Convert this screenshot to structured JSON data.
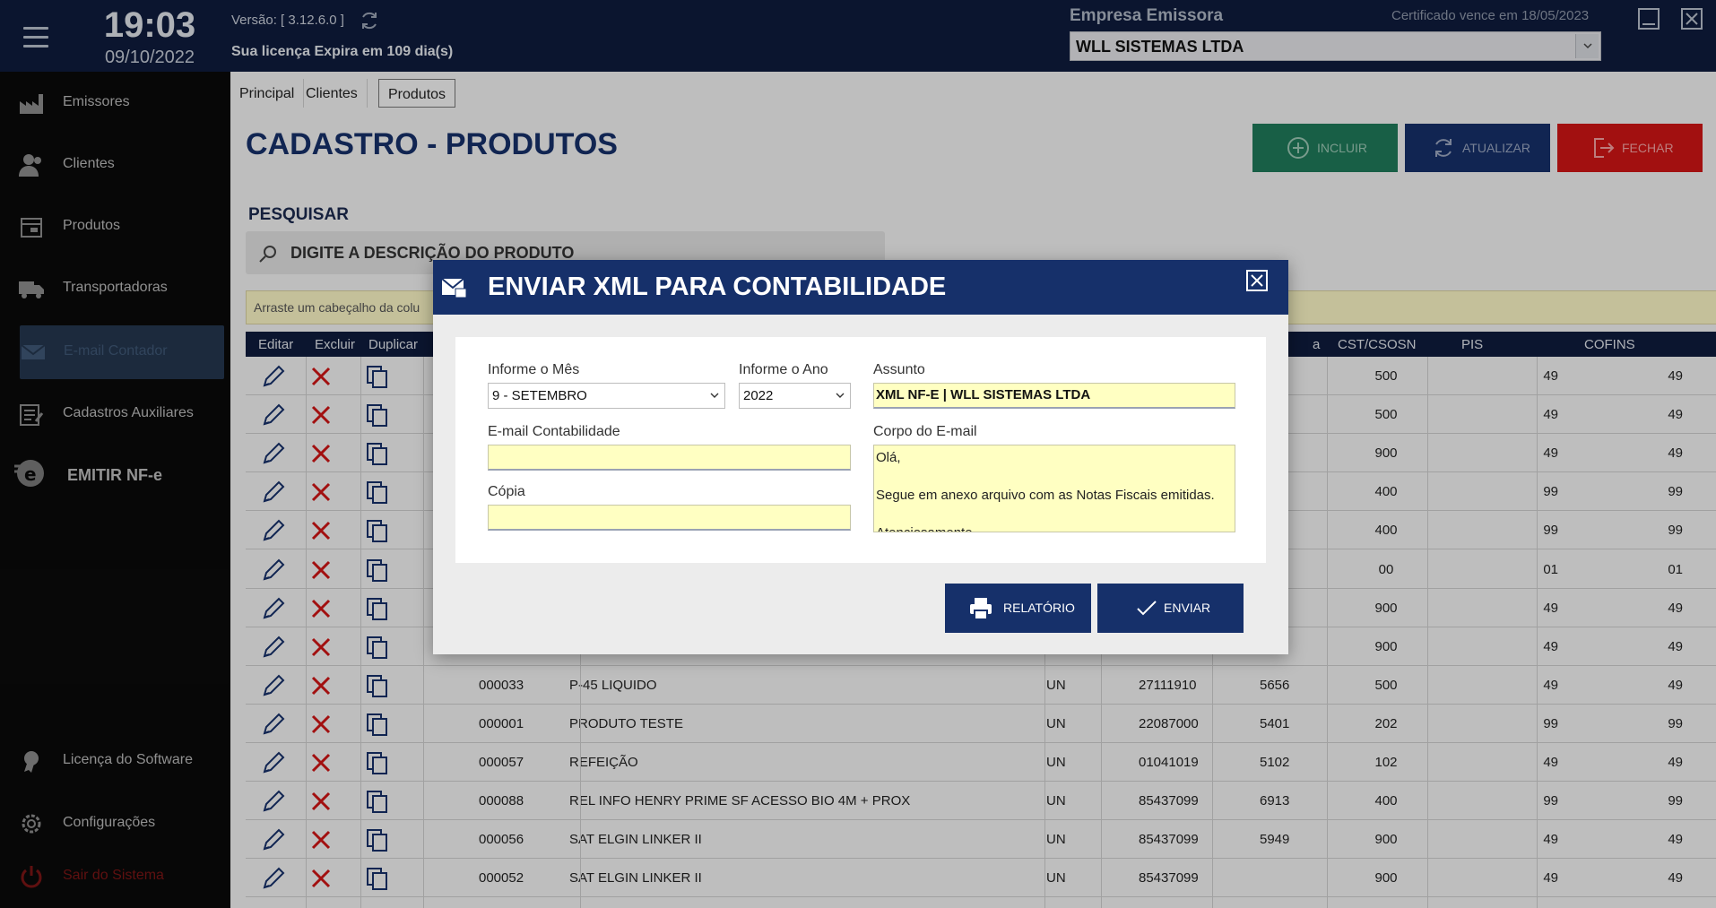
{
  "header": {
    "time": "19:03",
    "date": "09/10/2022",
    "version": "Versão: [ 3.12.6.0 ]",
    "license_notice": "Sua licença Expira em 109 dia(s)",
    "company_label": "Empresa Emissora",
    "certificate_notice": "Certificado vence em 18/05/2023",
    "company_selected": "WLL SISTEMAS LTDA"
  },
  "sidebar": {
    "items": [
      {
        "label": "Emissores",
        "icon": "factory-icon"
      },
      {
        "label": "Clientes",
        "icon": "users-icon"
      },
      {
        "label": "Produtos",
        "icon": "box-icon"
      },
      {
        "label": "Transportadoras",
        "icon": "truck-icon"
      },
      {
        "label": "E-mail Contador",
        "icon": "mail-icon"
      },
      {
        "label": "Cadastros Auxiliares",
        "icon": "form-icon"
      },
      {
        "label": "EMITIR NF-e",
        "icon": "emit-icon"
      },
      {
        "label": "Licença do Software",
        "icon": "certificate-icon"
      },
      {
        "label": "Configurações",
        "icon": "gear-icon"
      },
      {
        "label": "Sair do Sistema",
        "icon": "power-icon"
      }
    ]
  },
  "tabs": [
    "Principal",
    "Clientes",
    "Produtos"
  ],
  "page": {
    "title": "CADASTRO - PRODUTOS",
    "btn_incluir": "INCLUIR",
    "btn_atualizar": "ATUALIZAR",
    "btn_fechar": "FECHAR",
    "search_label": "PESQUISAR",
    "search_placeholder": "DIGITE A DESCRIÇÃO DO PRODUTO",
    "group_hint": "Arraste um cabeçalho da colu",
    "colors": {
      "incluir": "#1f7a5a",
      "atualizar": "#16306a",
      "fechar": "#d01515"
    }
  },
  "grid": {
    "headers": [
      "Editar",
      "Excluir",
      "Duplicar",
      "a",
      "CST/CSOSN",
      "PIS",
      "COFINS"
    ],
    "rows": [
      {
        "code": "",
        "desc": "",
        "un": "",
        "ncm": "",
        "cfop": "",
        "cst": "500",
        "pis": "49",
        "cofins": "49"
      },
      {
        "code": "",
        "desc": "",
        "un": "",
        "ncm": "",
        "cfop": "",
        "cst": "500",
        "pis": "49",
        "cofins": "49"
      },
      {
        "code": "",
        "desc": "",
        "un": "",
        "ncm": "",
        "cfop": "",
        "cst": "900",
        "pis": "49",
        "cofins": "49"
      },
      {
        "code": "",
        "desc": "",
        "un": "",
        "ncm": "",
        "cfop": "",
        "cst": "400",
        "pis": "99",
        "cofins": "99"
      },
      {
        "code": "",
        "desc": "",
        "un": "",
        "ncm": "",
        "cfop": "",
        "cst": "400",
        "pis": "99",
        "cofins": "99"
      },
      {
        "code": "",
        "desc": "",
        "un": "",
        "ncm": "",
        "cfop": "",
        "cst": "00",
        "pis": "01",
        "cofins": "01"
      },
      {
        "code": "",
        "desc": "",
        "un": "",
        "ncm": "",
        "cfop": "",
        "cst": "900",
        "pis": "49",
        "cofins": "49"
      },
      {
        "code": "",
        "desc": "",
        "un": "",
        "ncm": "",
        "cfop": "",
        "cst": "900",
        "pis": "49",
        "cofins": "49"
      },
      {
        "code": "000033",
        "desc": "P-45 LIQUIDO",
        "un": "UN",
        "ncm": "27111910",
        "cfop": "5656",
        "cst": "500",
        "pis": "49",
        "cofins": "49"
      },
      {
        "code": "000001",
        "desc": "PRODUTO TESTE",
        "un": "UN",
        "ncm": "22087000",
        "cfop": "5401",
        "cst": "202",
        "pis": "99",
        "cofins": "99"
      },
      {
        "code": "000057",
        "desc": "REFEIÇÃO",
        "un": "UN",
        "ncm": "01041019",
        "cfop": "5102",
        "cst": "102",
        "pis": "49",
        "cofins": "49"
      },
      {
        "code": "000088",
        "desc": "REL INFO HENRY PRIME SF ACESSO BIO 4M + PROX",
        "un": "UN",
        "ncm": "85437099",
        "cfop": "6913",
        "cst": "400",
        "pis": "99",
        "cofins": "99"
      },
      {
        "code": "000056",
        "desc": "SAT ELGIN LINKER II",
        "un": "UN",
        "ncm": "85437099",
        "cfop": "5949",
        "cst": "900",
        "pis": "49",
        "cofins": "49"
      },
      {
        "code": "000052",
        "desc": "SAT ELGIN LINKER II",
        "un": "UN",
        "ncm": "85437099",
        "cfop": "",
        "cst": "900",
        "pis": "49",
        "cofins": "49"
      }
    ]
  },
  "dialog": {
    "title": "ENVIAR XML PARA CONTABILIDADE",
    "month_label": "Informe o Mês",
    "month_value": "9 - SETEMBRO",
    "year_label": "Informe o Ano",
    "year_value": "2022",
    "subject_label": "Assunto",
    "subject_value": "XML NF-E | WLL SISTEMAS LTDA",
    "email_label": "E-mail Contabilidade",
    "email_value": "",
    "copy_label": "Cópia",
    "copy_value": "",
    "body_label": "Corpo do E-mail",
    "body_line1": "Olá,",
    "body_line2": "Segue em anexo arquivo com as Notas Fiscais emitidas.",
    "body_line3": "Atenciosamente",
    "btn_report": "RELATÓRIO",
    "btn_send": "ENVIAR"
  }
}
